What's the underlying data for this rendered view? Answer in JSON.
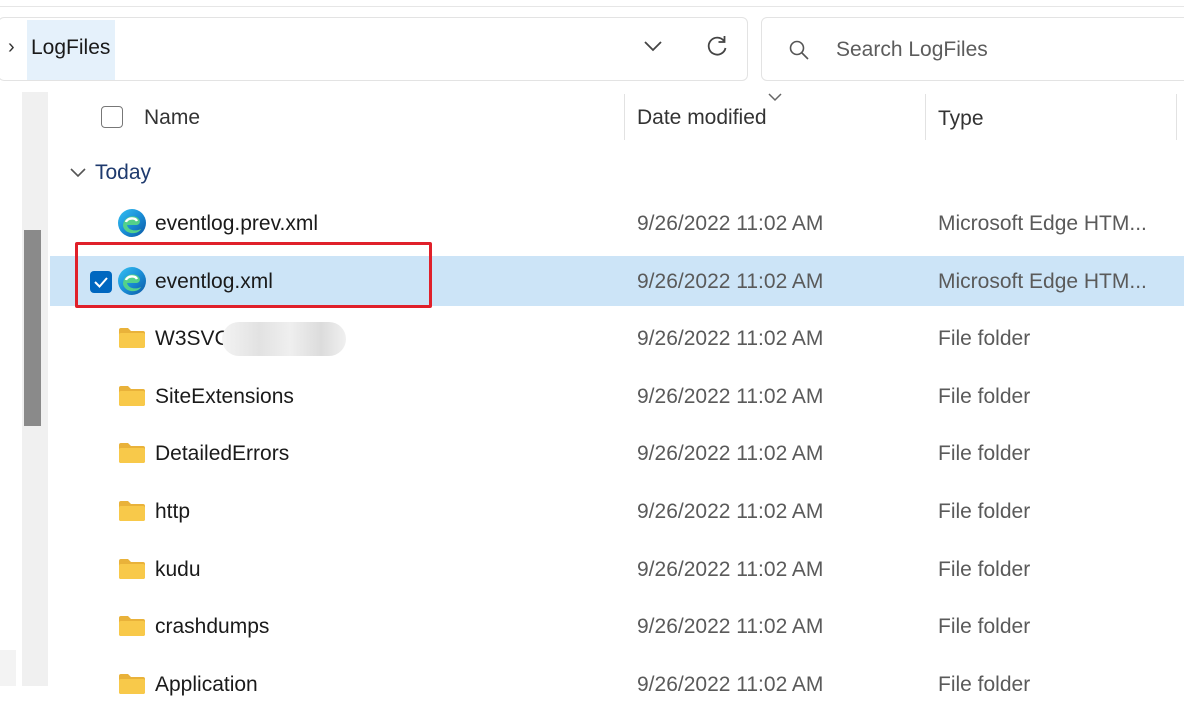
{
  "address": {
    "separator": "›",
    "current_folder": "LogFiles"
  },
  "search": {
    "placeholder": "Search LogFiles"
  },
  "columns": {
    "name": "Name",
    "date_modified": "Date modified",
    "type": "Type"
  },
  "group": {
    "label": "Today"
  },
  "rows": [
    {
      "name": "eventlog.prev.xml",
      "date": "9/26/2022 11:02 AM",
      "type": "Microsoft Edge HTM...",
      "icon": "edge-icon",
      "selected": false
    },
    {
      "name": "eventlog.xml",
      "date": "9/26/2022 11:02 AM",
      "type": "Microsoft Edge HTM...",
      "icon": "edge-icon",
      "selected": true
    },
    {
      "name": "W3SVC",
      "date": "9/26/2022 11:02 AM",
      "type": "File folder",
      "icon": "folder-icon",
      "selected": false
    },
    {
      "name": "SiteExtensions",
      "date": "9/26/2022 11:02 AM",
      "type": "File folder",
      "icon": "folder-icon",
      "selected": false
    },
    {
      "name": "DetailedErrors",
      "date": "9/26/2022 11:02 AM",
      "type": "File folder",
      "icon": "folder-icon",
      "selected": false
    },
    {
      "name": "http",
      "date": "9/26/2022 11:02 AM",
      "type": "File folder",
      "icon": "folder-icon",
      "selected": false
    },
    {
      "name": "kudu",
      "date": "9/26/2022 11:02 AM",
      "type": "File folder",
      "icon": "folder-icon",
      "selected": false
    },
    {
      "name": "crashdumps",
      "date": "9/26/2022 11:02 AM",
      "type": "File folder",
      "icon": "folder-icon",
      "selected": false
    },
    {
      "name": "Application",
      "date": "9/26/2022 11:02 AM",
      "type": "File folder",
      "icon": "folder-icon",
      "selected": false
    }
  ],
  "colors": {
    "selection": "#cce4f7",
    "accent": "#0067c0",
    "highlight_box": "#e0202a",
    "folder": "#f8c94a"
  }
}
